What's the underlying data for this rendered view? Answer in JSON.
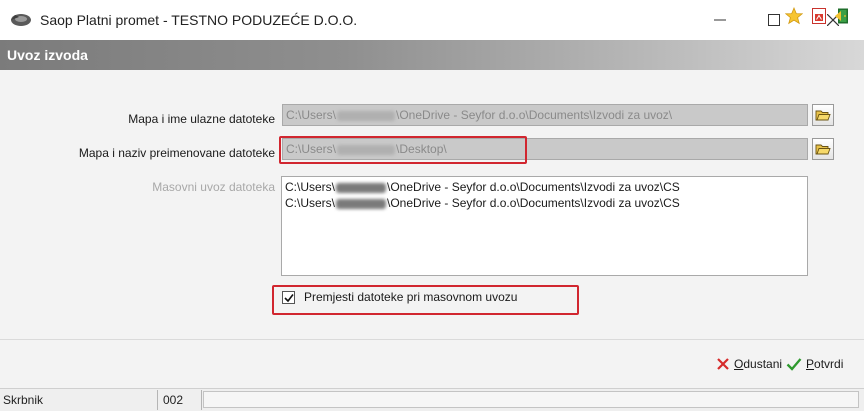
{
  "window": {
    "title": "Saop Platni promet - TESTNO PODUZEĆE D.O.O.",
    "minimize_glyph": "—",
    "maximize_glyph": "☐",
    "close_glyph": "✕"
  },
  "header": {
    "title": "Uvoz izvoda",
    "icons": [
      "star-icon",
      "pdf-icon",
      "exit-door-icon"
    ]
  },
  "form": {
    "input_path": {
      "label": "Mapa i ime ulazne datoteke",
      "prefix": "C:\\Users\\",
      "suffix": "\\OneDrive - Seyfor d.o.o\\Documents\\Izvodi za uvoz\\"
    },
    "rename_path": {
      "label": "Mapa i naziv preimenovane datoteke",
      "prefix": "C:\\Users\\",
      "suffix": "\\Desktop\\"
    },
    "mass_import": {
      "label": "Masovni uvoz datoteka",
      "rows": [
        {
          "prefix": "C:\\Users\\",
          "suffix": "\\OneDrive - Seyfor d.o.o\\Documents\\Izvodi za uvoz\\CS"
        },
        {
          "prefix": "C:\\Users\\",
          "suffix": "\\OneDrive - Seyfor d.o.o\\Documents\\Izvodi za uvoz\\CS"
        }
      ]
    },
    "move_files_checkbox": {
      "label": "Premjesti datoteke pri masovnom uvozu",
      "checked": true
    }
  },
  "actions": {
    "cancel": {
      "first_letter": "O",
      "rest": "dustani"
    },
    "confirm": {
      "first_letter": "P",
      "rest": "otvrdi"
    }
  },
  "statusbar": {
    "user": "Skrbnik",
    "code": "002"
  },
  "colors": {
    "highlight": "#d1262f",
    "cancel_icon": "#d62b2b",
    "confirm_icon": "#2e9a2e"
  }
}
